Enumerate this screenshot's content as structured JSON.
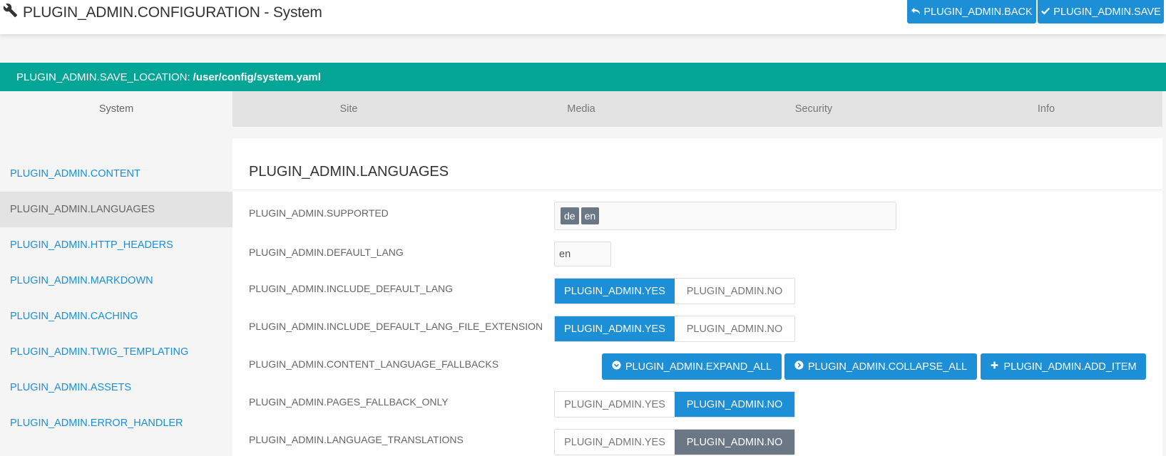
{
  "header": {
    "title": "PLUGIN_ADMIN.CONFIGURATION - System",
    "title_icon": "wrench-icon",
    "back_label": "PLUGIN_ADMIN.BACK",
    "save_label": "PLUGIN_ADMIN.SAVE"
  },
  "save_location": {
    "label": "PLUGIN_ADMIN.SAVE_LOCATION:",
    "path": "/user/config/system.yaml",
    "color": "#03a596"
  },
  "tabs": [
    {
      "label": "System",
      "active": true
    },
    {
      "label": "Site"
    },
    {
      "label": "Media"
    },
    {
      "label": "Security"
    },
    {
      "label": "Info"
    }
  ],
  "sidebar": {
    "items": [
      {
        "label": "PLUGIN_ADMIN.CONTENT"
      },
      {
        "label": "PLUGIN_ADMIN.LANGUAGES",
        "active": true
      },
      {
        "label": "PLUGIN_ADMIN.HTTP_HEADERS"
      },
      {
        "label": "PLUGIN_ADMIN.MARKDOWN"
      },
      {
        "label": "PLUGIN_ADMIN.CACHING"
      },
      {
        "label": "PLUGIN_ADMIN.TWIG_TEMPLATING"
      },
      {
        "label": "PLUGIN_ADMIN.ASSETS"
      },
      {
        "label": "PLUGIN_ADMIN.ERROR_HANDLER"
      }
    ]
  },
  "section": {
    "title": "PLUGIN_ADMIN.LANGUAGES",
    "fields": {
      "supported": {
        "label": "PLUGIN_ADMIN.SUPPORTED",
        "values": [
          "de",
          "en"
        ]
      },
      "default_lang": {
        "label": "PLUGIN_ADMIN.DEFAULT_LANG",
        "value": "en"
      },
      "include_default_lang": {
        "label": "PLUGIN_ADMIN.INCLUDE_DEFAULT_LANG",
        "yes": "PLUGIN_ADMIN.YES",
        "no": "PLUGIN_ADMIN.NO",
        "selected": "yes"
      },
      "include_default_lang_file_extension": {
        "label": "PLUGIN_ADMIN.INCLUDE_DEFAULT_LANG_FILE_EXTENSION",
        "yes": "PLUGIN_ADMIN.YES",
        "no": "PLUGIN_ADMIN.NO",
        "selected": "yes"
      },
      "content_language_fallbacks": {
        "label": "PLUGIN_ADMIN.CONTENT_LANGUAGE_FALLBACKS",
        "expand_all": "PLUGIN_ADMIN.EXPAND_ALL",
        "collapse_all": "PLUGIN_ADMIN.COLLAPSE_ALL",
        "add_item": "PLUGIN_ADMIN.ADD_ITEM"
      },
      "pages_fallback_only": {
        "label": "PLUGIN_ADMIN.PAGES_FALLBACK_ONLY",
        "yes": "PLUGIN_ADMIN.YES",
        "no": "PLUGIN_ADMIN.NO",
        "selected": "no"
      },
      "language_translations": {
        "label": "PLUGIN_ADMIN.LANGUAGE_TRANSLATIONS",
        "yes": "PLUGIN_ADMIN.YES",
        "no": "PLUGIN_ADMIN.NO",
        "selected": "no"
      }
    }
  },
  "colors": {
    "accent": "#1c8fd6",
    "teal": "#03a596",
    "chip": "#6b7785"
  }
}
